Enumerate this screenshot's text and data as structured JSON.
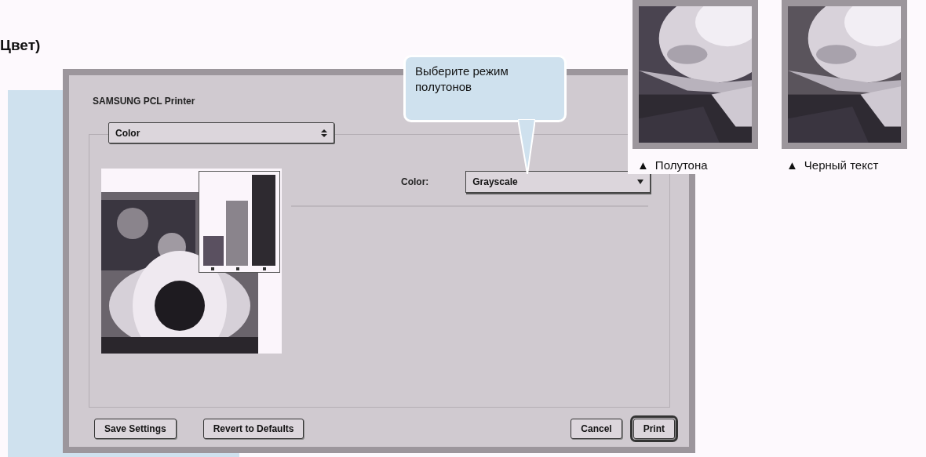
{
  "heading": "Цвет)",
  "dialog": {
    "title": "SAMSUNG PCL Printer",
    "panel_menu": {
      "value": "Color"
    },
    "color_label": "Color:",
    "color_select": {
      "value": "Grayscale"
    },
    "buttons": [
      {
        "label": "Save Settings",
        "default": false
      },
      {
        "label": "Revert to Defaults",
        "default": false
      },
      {
        "label": "Cancel",
        "default": false
      },
      {
        "label": "Print",
        "default": true
      }
    ]
  },
  "callout": "Выберите режим полутонов",
  "samples": [
    {
      "marker": "▲",
      "caption": "Полутона"
    },
    {
      "marker": "▲",
      "caption": "Черный текст"
    }
  ]
}
